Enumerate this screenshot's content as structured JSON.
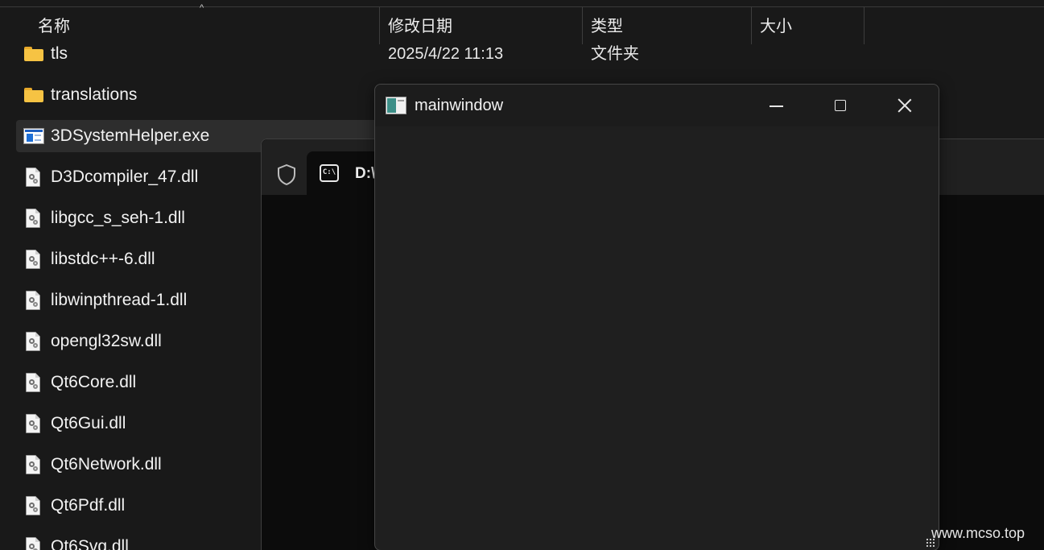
{
  "explorer": {
    "columns": [
      {
        "key": "name",
        "label": "名称"
      },
      {
        "key": "modified",
        "label": "修改日期"
      },
      {
        "key": "type",
        "label": "类型"
      },
      {
        "key": "size",
        "label": "大小"
      }
    ],
    "sort_indicator": "^",
    "files": [
      {
        "name": "tls",
        "icon": "folder-icon",
        "modified": "2025/4/22 11:13",
        "type": "文件夹"
      },
      {
        "name": "translations",
        "icon": "folder-icon"
      },
      {
        "name": "3DSystemHelper.exe",
        "icon": "exe-icon",
        "selected": true
      },
      {
        "name": "D3Dcompiler_47.dll",
        "icon": "dll-icon"
      },
      {
        "name": "libgcc_s_seh-1.dll",
        "icon": "dll-icon"
      },
      {
        "name": "libstdc++-6.dll",
        "icon": "dll-icon"
      },
      {
        "name": "libwinpthread-1.dll",
        "icon": "dll-icon"
      },
      {
        "name": "opengl32sw.dll",
        "icon": "dll-icon"
      },
      {
        "name": "Qt6Core.dll",
        "icon": "dll-icon"
      },
      {
        "name": "Qt6Gui.dll",
        "icon": "dll-icon"
      },
      {
        "name": "Qt6Network.dll",
        "icon": "dll-icon"
      },
      {
        "name": "Qt6Pdf.dll",
        "icon": "dll-icon"
      },
      {
        "name": "Qt6Svg.dll",
        "icon": "dll-icon"
      }
    ]
  },
  "terminal": {
    "tab_title": "D:\\",
    "icon": "command-prompt-icon",
    "shield_icon": "shield-icon"
  },
  "mainwindow": {
    "title": "mainwindow",
    "icon": "app-window-icon"
  },
  "watermark": "www.mcso.top"
}
